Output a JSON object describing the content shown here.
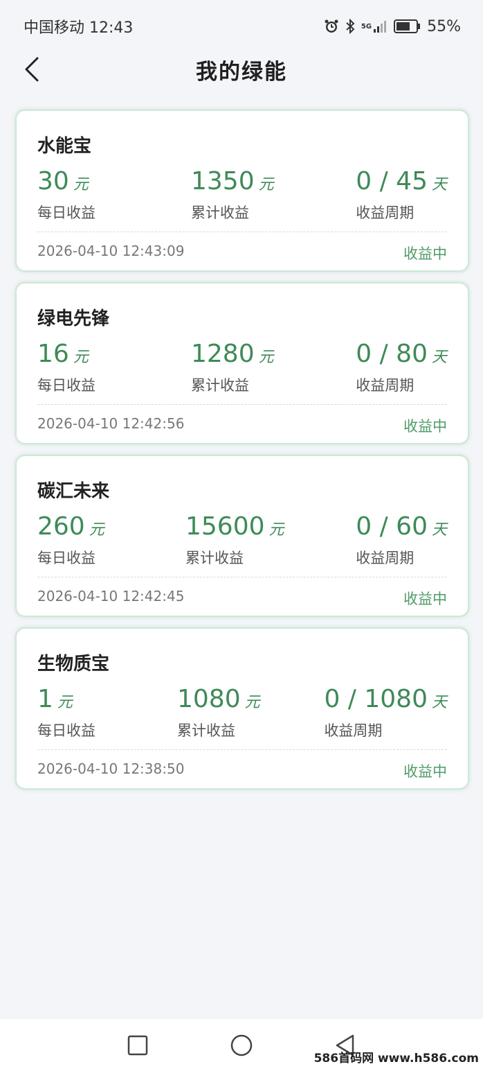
{
  "status_bar": {
    "carrier_time": "中国移动 12:43",
    "network": "5G",
    "battery": "55%"
  },
  "header": {
    "title": "我的绿能"
  },
  "labels": {
    "daily": "每日收益",
    "total": "累计收益",
    "cycle": "收益周期",
    "unit_yuan": "元",
    "unit_day": "天"
  },
  "cards": [
    {
      "name": "水能宝",
      "daily": "30",
      "total": "1350",
      "cycle": "0 / 45",
      "time": "2026-04-10 12:43:09",
      "status": "收益中"
    },
    {
      "name": "绿电先锋",
      "daily": "16",
      "total": "1280",
      "cycle": "0 / 80",
      "time": "2026-04-10 12:42:56",
      "status": "收益中"
    },
    {
      "name": "碳汇未来",
      "daily": "260",
      "total": "15600",
      "cycle": "0 / 60",
      "time": "2026-04-10 12:42:45",
      "status": "收益中"
    },
    {
      "name": "生物质宝",
      "daily": "1",
      "total": "1080",
      "cycle": "0 / 1080",
      "time": "2026-04-10 12:38:50",
      "status": "收益中"
    }
  ],
  "watermark": "586首码网 www.h586.com",
  "colors": {
    "accent_green": "#3e8a58",
    "background": "#f4f5f8"
  },
  "icons": [
    "back-arrow-icon",
    "alarm-icon",
    "bluetooth-icon",
    "signal-icon",
    "battery-icon",
    "square-nav-icon",
    "circle-nav-icon",
    "triangle-nav-icon"
  ]
}
